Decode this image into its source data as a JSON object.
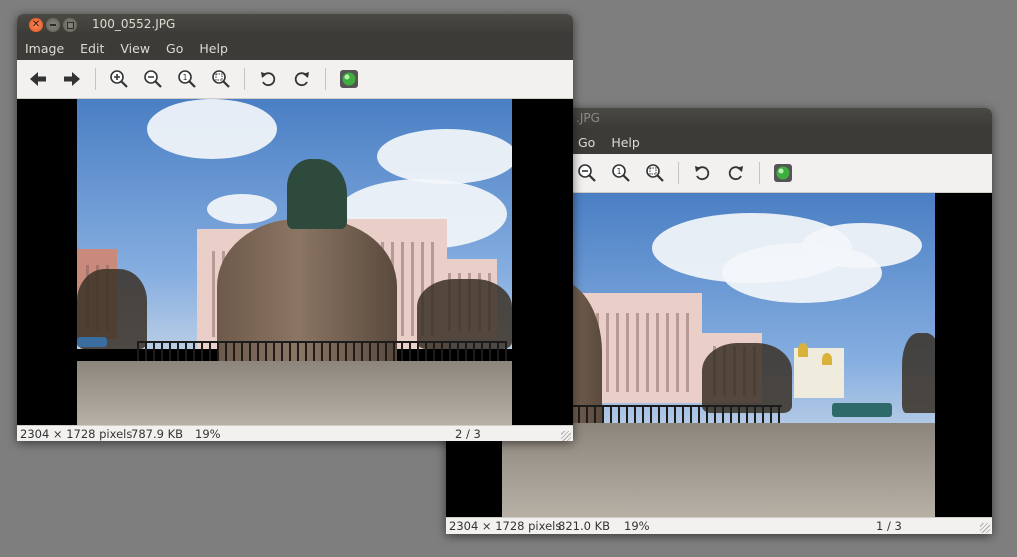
{
  "back_window": {
    "title": ".JPG",
    "menu": [
      "Go",
      "Help"
    ],
    "status": {
      "dimensions": "2304 × 1728 pixels",
      "size": "821.0 KB",
      "zoom": "19%",
      "position": "1 / 3"
    }
  },
  "front_window": {
    "title": "100_0552.JPG",
    "menu": [
      "Image",
      "Edit",
      "View",
      "Go",
      "Help"
    ],
    "status": {
      "dimensions": "2304 × 1728 pixels",
      "size": "787.9 KB",
      "zoom": "19%",
      "position": "2 / 3"
    }
  },
  "toolbar_icons": [
    "back-arrow-icon",
    "forward-arrow-icon",
    "zoom-in-icon",
    "zoom-out-icon",
    "zoom-normal-icon",
    "zoom-fit-icon",
    "rotate-left-icon",
    "rotate-right-icon",
    "slideshow-icon"
  ],
  "colors": {
    "titlebar": "#3c3b37",
    "close_button": "#e95420",
    "desktop": "#7e7e7e"
  }
}
